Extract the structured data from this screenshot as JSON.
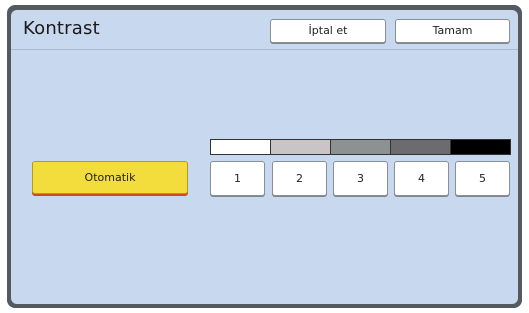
{
  "dialog": {
    "title": "Kontrast",
    "cancel_label": "İptal et",
    "ok_label": "Tamam"
  },
  "contrast": {
    "auto_label": "Otomatik",
    "levels": [
      "1",
      "2",
      "3",
      "4",
      "5"
    ],
    "scale_colors": [
      "#ffffff",
      "#c9c4c6",
      "#8c9191",
      "#6b6b70",
      "#000000"
    ]
  },
  "colors": {
    "panel_bg": "#c8d9ef",
    "frame": "#555a60",
    "auto_button": "#f3dd3d",
    "auto_underline": "#d04a1c"
  }
}
